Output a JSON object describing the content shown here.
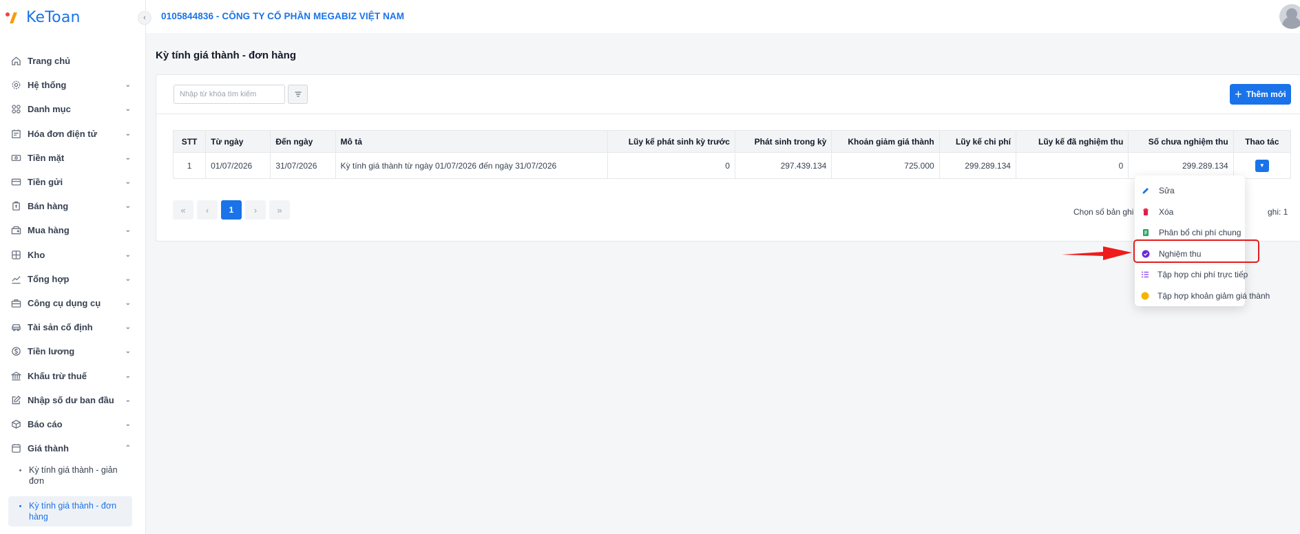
{
  "app": {
    "logo": "KeToan"
  },
  "header": {
    "company": "0105844836 - CÔNG TY CỔ PHẦN MEGABIZ VIỆT NAM"
  },
  "sidebar": {
    "items": [
      {
        "label": "Trang chủ",
        "icon": "home-icon"
      },
      {
        "label": "Hệ thống",
        "icon": "gear-icon"
      },
      {
        "label": "Danh mục",
        "icon": "grid-icon"
      },
      {
        "label": "Hóa đơn điện tử",
        "icon": "invoice-icon"
      },
      {
        "label": "Tiền mặt",
        "icon": "cash-icon"
      },
      {
        "label": "Tiền gửi",
        "icon": "card-icon"
      },
      {
        "label": "Bán hàng",
        "icon": "sale-icon"
      },
      {
        "label": "Mua hàng",
        "icon": "purchase-icon"
      },
      {
        "label": "Kho",
        "icon": "warehouse-icon"
      },
      {
        "label": "Tổng hợp",
        "icon": "chart-icon"
      },
      {
        "label": "Công cụ dụng cụ",
        "icon": "tool-icon"
      },
      {
        "label": "Tài sản cố định",
        "icon": "car-icon"
      },
      {
        "label": "Tiền lương",
        "icon": "salary-icon"
      },
      {
        "label": "Khấu trừ thuế",
        "icon": "tax-icon"
      },
      {
        "label": "Nhập số dư ban đầu",
        "icon": "edit-icon"
      },
      {
        "label": "Báo cáo",
        "icon": "report-icon"
      },
      {
        "label": "Giá thành",
        "icon": "cost-icon"
      }
    ],
    "subitems": [
      {
        "label": "Kỳ tính giá thành - giản đơn"
      },
      {
        "label": "Kỳ tính giá thành - đơn hàng"
      }
    ]
  },
  "page": {
    "title": "Kỳ tính giá thành - đơn hàng"
  },
  "toolbar": {
    "search_placeholder": "Nhập từ khóa tìm kiếm",
    "add_label": "Thêm mới"
  },
  "table": {
    "headers": [
      "STT",
      "Từ ngày",
      "Đến ngày",
      "Mô tả",
      "Lũy kế phát sinh kỳ trước",
      "Phát sinh trong kỳ",
      "Khoản giảm giá thành",
      "Lũy kế chi phí",
      "Lũy kế đã nghiệm thu",
      "Số chưa nghiệm thu",
      "Thao tác"
    ],
    "rows": [
      [
        "1",
        "01/07/2026",
        "31/07/2026",
        "Kỳ tính giá thành từ ngày 01/07/2026 đến ngày 31/07/2026",
        "0",
        "297.439.134",
        "725.000",
        "299.289.134",
        "0",
        "299.289.134"
      ]
    ]
  },
  "pagination": {
    "current": "1",
    "page_size_label": "Chọn số bản ghi",
    "record_label": "ghi:",
    "record_count": "1"
  },
  "menu": {
    "items": [
      {
        "label": "Sửa",
        "icon": "pencil-icon",
        "color": "#1a73e8"
      },
      {
        "label": "Xóa",
        "icon": "trash-icon",
        "color": "#e11d48"
      },
      {
        "label": "Phân bổ chi phí chung",
        "icon": "document-icon",
        "color": "#22a55b"
      },
      {
        "label": "Nghiệm thu",
        "icon": "check-circle-icon",
        "color": "#6d28d9"
      },
      {
        "label": "Tập hợp chi phí trực tiếp",
        "icon": "list-icon",
        "color": "#7c3aed"
      },
      {
        "label": "Tập hợp khoản giảm giá thành",
        "icon": "coin-icon",
        "color": "#f5b400"
      }
    ]
  },
  "colors": {
    "accent": "#1a73e8",
    "highlight": "#e11d1d"
  }
}
